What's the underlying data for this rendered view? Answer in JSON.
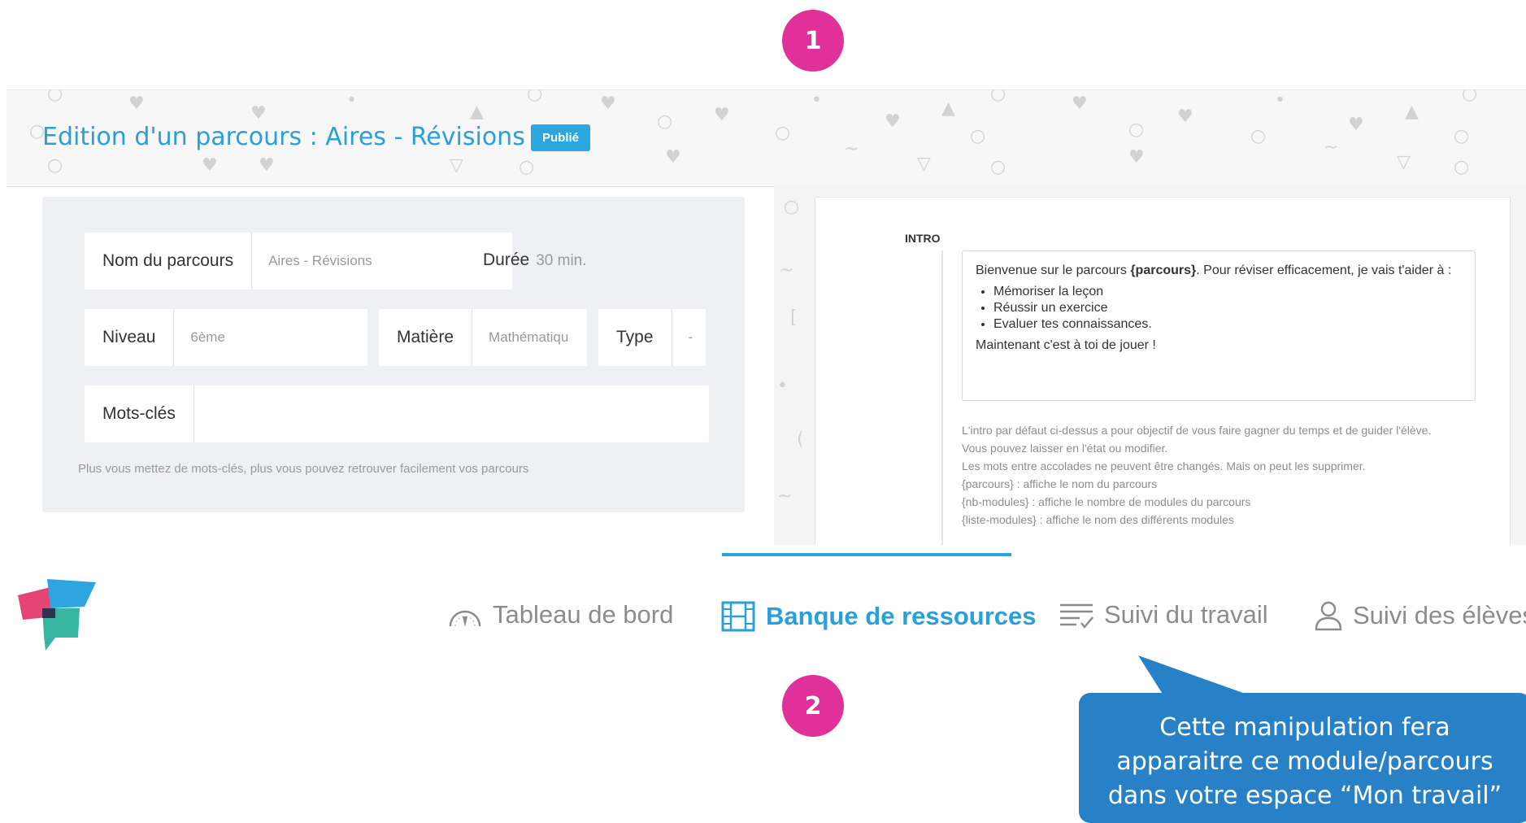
{
  "steps": {
    "one": "1",
    "two": "2"
  },
  "editor": {
    "title": "Edition d'un parcours : Aires - Révisions",
    "status_badge": "Publié",
    "form": {
      "name_label": "Nom du parcours",
      "name_value": "Aires - Révisions",
      "duration_label": "Durée",
      "duration_value": "30 min.",
      "level_label": "Niveau",
      "level_value": "6ème",
      "subject_label": "Matière",
      "subject_value": "Mathématiqu",
      "type_label": "Type",
      "type_value": "-",
      "keywords_label": "Mots-clés",
      "keywords_value": "",
      "hint": "Plus vous mettez de mots-clés, plus vous pouvez retrouver facilement vos parcours"
    },
    "intro": {
      "label": "INTRO",
      "welcome_pre": "Bienvenue sur le parcours ",
      "welcome_var": "{parcours}",
      "welcome_post": ". Pour réviser efficacement, je vais t'aider à :",
      "bullets": [
        "Mémoriser la leçon",
        "Réussir un exercice",
        "Evaluer tes connaissances."
      ],
      "closing": "Maintenant c'est à toi de jouer !",
      "notes": [
        "L'intro par défaut ci-dessus a pour objectif de vous faire gagner du temps et de guider l'élève.",
        "Vous pouvez laisser en l'état ou modifier.",
        "Les mots entre accolades ne peuvent être changés. Mais on peut les supprimer.",
        "{parcours} : affiche le nom du parcours",
        "{nb-modules} : affiche le nombre de modules du parcours",
        "{liste-modules} : affiche le nom des différents modules"
      ]
    }
  },
  "nav": {
    "items": [
      {
        "label": "Tableau de bord",
        "icon": "gauge-icon"
      },
      {
        "label": "Banque de ressources",
        "icon": "film-icon"
      },
      {
        "label": "Suivi du travail",
        "icon": "checklist-icon"
      },
      {
        "label": "Suivi des élèves",
        "icon": "user-icon"
      }
    ],
    "active_index": 1
  },
  "callout": {
    "line1": "Cette manipulation fera",
    "line2": "apparaitre ce module/parcours",
    "line3": "dans votre espace “Mon travail”"
  },
  "colors": {
    "accent": "#2aa0d8",
    "step_badge": "#e0309a",
    "callout": "#2881c6"
  }
}
